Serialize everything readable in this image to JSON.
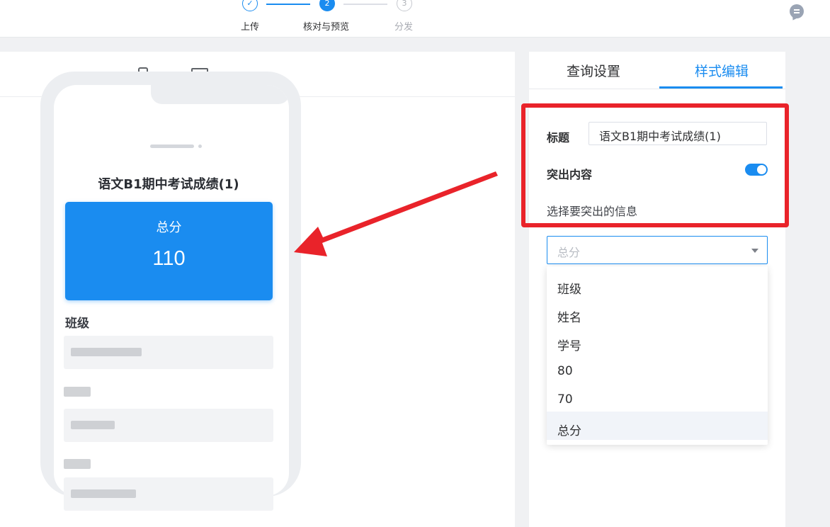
{
  "steps": [
    {
      "label": "上传",
      "marker": "✓",
      "state": "done"
    },
    {
      "label": "核对与预览",
      "marker": "2",
      "state": "active"
    },
    {
      "label": "分发",
      "marker": "3",
      "state": "todo"
    }
  ],
  "preview": {
    "devices": [
      "phone-icon",
      "monitor-icon"
    ],
    "phone_title": "语文B1期中考试成绩(1)",
    "highlight": {
      "label": "总分",
      "value": "110"
    },
    "fields": [
      {
        "label": "班级"
      }
    ]
  },
  "settings": {
    "tabs": [
      {
        "label": "查询设置",
        "active": false
      },
      {
        "label": "样式编辑",
        "active": true
      }
    ],
    "title_label": "标题",
    "title_value": "语文B1期中考试成绩(1)",
    "highlight_label": "突出内容",
    "highlight_enabled": true,
    "select_info_label": "选择要突出的信息",
    "select_placeholder": "总分",
    "options": [
      "班级",
      "姓名",
      "学号",
      "80",
      "70",
      "总分"
    ],
    "selected_option": "总分"
  },
  "colors": {
    "accent": "#1a8cf0",
    "annotation": "#e9232a"
  }
}
